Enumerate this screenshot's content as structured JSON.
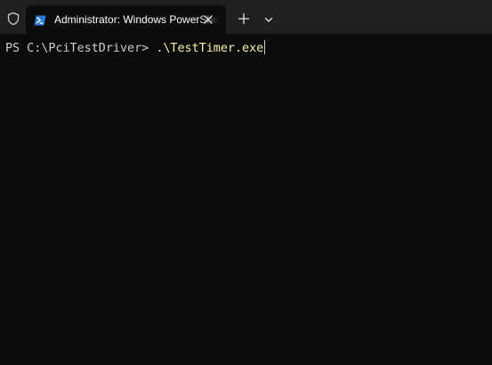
{
  "tabbar": {
    "shield_icon": "shield-icon",
    "tab": {
      "icon": "powershell-icon",
      "title": "Administrator: Windows PowerShell",
      "close_icon": "close-icon"
    },
    "new_tab_icon": "plus-icon",
    "dropdown_icon": "chevron-down-icon"
  },
  "terminal": {
    "prompt": "PS C:\\PciTestDriver> ",
    "command": ".\\TestTimer.exe"
  },
  "colors": {
    "tabbar_bg": "#202020",
    "terminal_bg": "#0c0c0c",
    "prompt_text": "#cccccc",
    "command_text": "#f9f1a5",
    "powershell_icon": "#2c7ad6"
  }
}
